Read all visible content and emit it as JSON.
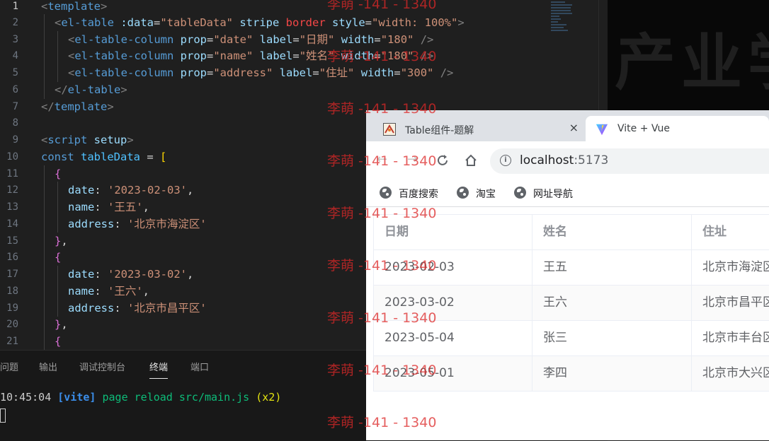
{
  "editor": {
    "line_numbers": [
      "1",
      "2",
      "3",
      "4",
      "5",
      "6",
      "7",
      "8",
      "9",
      "10",
      "11",
      "12",
      "13",
      "14",
      "15",
      "16",
      "17",
      "18",
      "19",
      "20",
      "21"
    ],
    "code": {
      "l1": [
        "<",
        "template",
        ">"
      ],
      "l2": [
        "<",
        "el-table",
        " :data",
        "=",
        "\"tableData\"",
        " stripe",
        " border",
        " style",
        "=",
        "\"width: 100%\"",
        ">"
      ],
      "l3": [
        "<",
        "el-table-column",
        " prop",
        "=",
        "\"date\"",
        " label",
        "=",
        "\"日期\"",
        " width",
        "=",
        "\"180\"",
        " />"
      ],
      "l4": [
        "<",
        "el-table-column",
        " prop",
        "=",
        "\"name\"",
        " label",
        "=",
        "\"姓名\"",
        " width",
        "=",
        "\"180\"",
        " />"
      ],
      "l5": [
        "<",
        "el-table-column",
        " prop",
        "=",
        "\"address\"",
        " label",
        "=",
        "\"住址\"",
        " width",
        "=",
        "\"300\"",
        " />"
      ],
      "l6": [
        "</",
        "el-table",
        ">"
      ],
      "l7": [
        "</",
        "template",
        ">"
      ],
      "l9": [
        "<",
        "script",
        " setup",
        ">"
      ],
      "l10": [
        "const",
        " tableData",
        " = ",
        "["
      ],
      "l11": "{",
      "l12": [
        "date",
        ": ",
        "'2023-02-03'",
        ","
      ],
      "l13": [
        "name",
        ": ",
        "'王五'",
        ","
      ],
      "l14": [
        "address",
        ": ",
        "'北京市海淀区'"
      ],
      "l15": [
        "}",
        ","
      ],
      "l16": "{",
      "l17": [
        "date",
        ": ",
        "'2023-03-02'",
        ","
      ],
      "l18": [
        "name",
        ": ",
        "'王六'",
        ","
      ],
      "l19": [
        "address",
        ": ",
        "'北京市昌平区'"
      ],
      "l20": [
        "}",
        ","
      ],
      "l21": "{"
    }
  },
  "panel": {
    "tabs": [
      "问题",
      "输出",
      "调试控制台",
      "终端",
      "端口"
    ],
    "terminal": {
      "time": "10:45:04",
      "tag": "[vite]",
      "message": "page reload src/main.js",
      "count": "(x2)"
    }
  },
  "background": {
    "text": "产业学"
  },
  "browser": {
    "tabs": [
      {
        "title": "Table组件-题解",
        "close": "×"
      },
      {
        "title": "Vite + Vue"
      }
    ],
    "url": {
      "host": "localhost",
      "port": ":5173"
    },
    "bookmarks": [
      "百度搜索",
      "淘宝",
      "网址导航"
    ],
    "table": {
      "headers": [
        "日期",
        "姓名",
        "住址"
      ],
      "rows": [
        [
          "2023-02-03",
          "王五",
          "北京市海淀区"
        ],
        [
          "2023-03-02",
          "王六",
          "北京市昌平区"
        ],
        [
          "2023-05-04",
          "张三",
          "北京市丰台区"
        ],
        [
          "2023-05-01",
          "李四",
          "北京市大兴区"
        ]
      ]
    }
  },
  "watermark": {
    "text": "李萌 -141 - 1340"
  },
  "colors": {
    "editor_bg": "#1f1f1f",
    "tag": "#569cd6",
    "attr": "#9cdcfe",
    "string": "#ce9178",
    "watermark": "#dc2828",
    "vite_blue": "#3b8eea",
    "terminal_green": "#0dbc79"
  }
}
